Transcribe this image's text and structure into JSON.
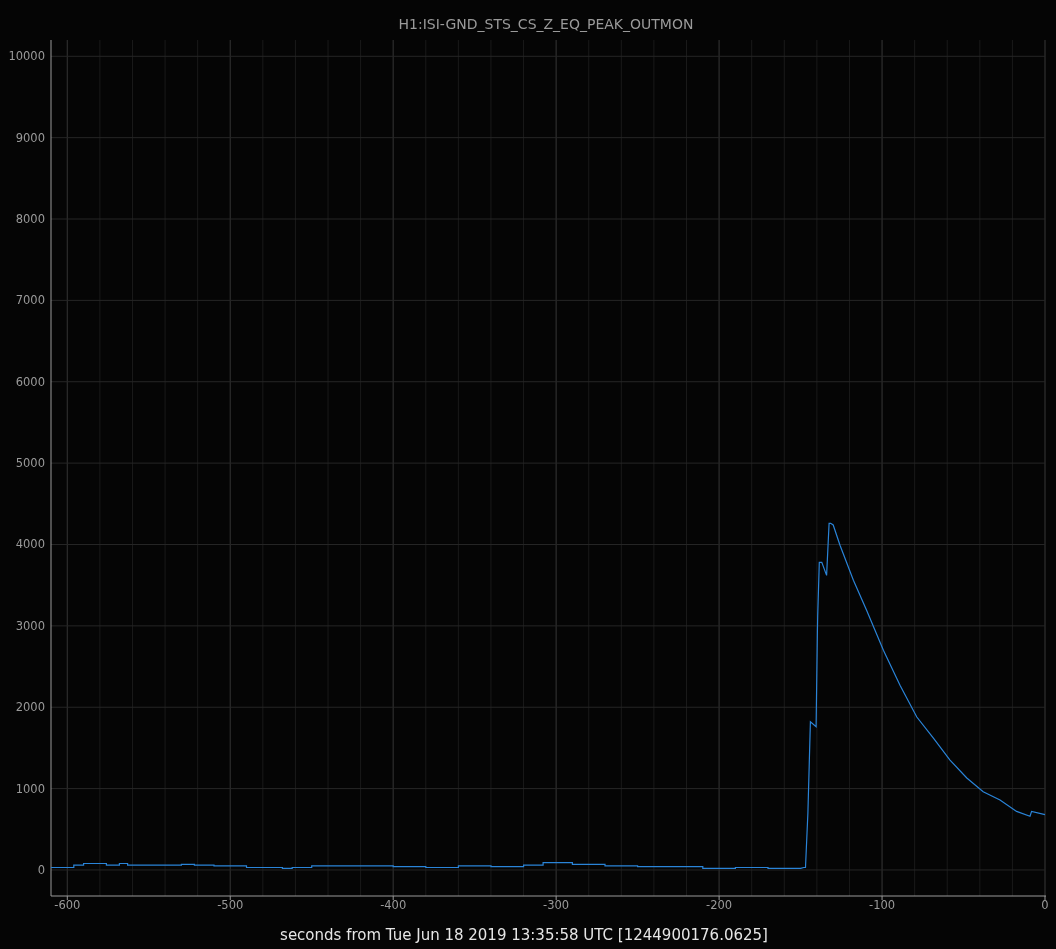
{
  "chart": {
    "chart_data": {
      "type": "line",
      "title": "H1:ISI-GND_STS_CS_Z_EQ_PEAK_OUTMON",
      "xlabel": "seconds from Tue Jun 18 2019 13:35:58 UTC [1244900176.0625]",
      "x": [
        -610,
        -596,
        -596,
        -590,
        -590,
        -576,
        -576,
        -568,
        -568,
        -563,
        -563,
        -540,
        -540,
        -530,
        -530,
        -522,
        -522,
        -510,
        -510,
        -490,
        -490,
        -468,
        -468,
        -462,
        -462,
        -450,
        -450,
        -440,
        -440,
        -420,
        -420,
        -400,
        -400,
        -380,
        -380,
        -360,
        -360,
        -340,
        -340,
        -320,
        -320,
        -308,
        -308,
        -290,
        -290,
        -270,
        -270,
        -250,
        -250,
        -230,
        -230,
        -210,
        -210,
        -190,
        -190,
        -170,
        -170,
        -150,
        -148,
        -147,
        -145.5,
        -144,
        -140.5,
        -139.7,
        -139.5,
        -138.5,
        -137,
        -134,
        -132.5,
        -131.5,
        -130,
        -125.8,
        -117.6,
        -109.4,
        -99.2,
        -89,
        -78.7,
        -68.5,
        -58.3,
        -48,
        -37.9,
        -27.6,
        -17.4,
        -9.2,
        -8.2,
        0
      ],
      "series": [
        {
          "color": "#2a84d8",
          "values": [
            30,
            30,
            60,
            60,
            80,
            80,
            60,
            60,
            80,
            80,
            60,
            60,
            60,
            60,
            70,
            70,
            60,
            60,
            50,
            50,
            30,
            30,
            20,
            20,
            30,
            30,
            50,
            50,
            50,
            50,
            50,
            50,
            40,
            40,
            30,
            30,
            50,
            50,
            40,
            40,
            60,
            60,
            90,
            90,
            70,
            70,
            50,
            50,
            40,
            40,
            40,
            40,
            20,
            20,
            30,
            30,
            20,
            20,
            30,
            30,
            700,
            1820,
            1760,
            2930,
            3120,
            3780,
            3780,
            3620,
            4260,
            4260,
            4240,
            3990,
            3560,
            3190,
            2700,
            2270,
            1880,
            1620,
            1350,
            1130,
            960,
            860,
            720,
            660,
            720,
            680
          ]
        }
      ],
      "grid": true,
      "xlim": [
        -610,
        0
      ],
      "ylim": [
        -320,
        10200
      ],
      "xticks": [
        -600,
        -500,
        -400,
        -300,
        -200,
        -100,
        0
      ],
      "yticks": [
        0,
        1000,
        2000,
        3000,
        4000,
        5000,
        6000,
        7000,
        8000,
        9000,
        10000
      ]
    }
  }
}
